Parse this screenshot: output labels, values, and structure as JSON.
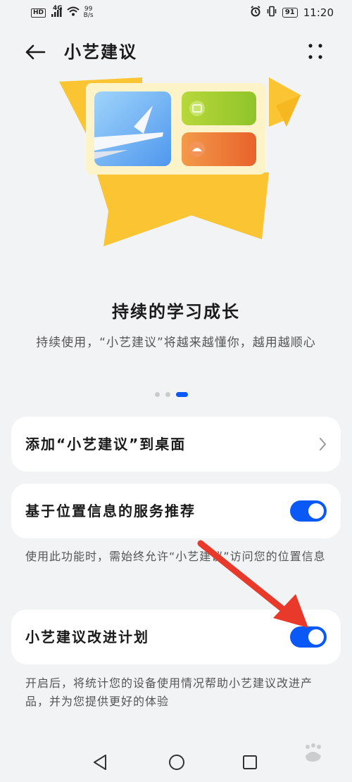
{
  "status_bar": {
    "hd": "HD",
    "net": "4G",
    "speed_value": "99",
    "speed_unit": "B/s",
    "battery": "91",
    "time": "11:20"
  },
  "header": {
    "title": "小艺建议"
  },
  "hero": {
    "headline": "持续的学习成长",
    "subtext": "持续使用，“小艺建议”将越来越懂你，越用越顺心",
    "page_count": 3,
    "active_page": 3
  },
  "settings": {
    "add_to_desktop": "添加“小艺建议”到桌面",
    "location_service": {
      "label": "基于位置信息的服务推荐",
      "enabled": true,
      "note": "使用此功能时，需始终允许“小艺建议”访问您的位置信息"
    },
    "improvement_plan": {
      "label": "小艺建议改进计划",
      "enabled": true,
      "note": "开启后，将统计您的设备使用情况帮助小艺建议改进产品，并为您提供更好的体验"
    }
  },
  "colors": {
    "accent": "#0a59f7",
    "annotation_arrow": "#e8392b"
  },
  "icons": {
    "back": "back-arrow-icon",
    "more": "more-dots-icon",
    "chevron": "chevron-right-icon",
    "nav_back": "triangle-back-icon",
    "nav_home": "circle-home-icon",
    "nav_recent": "square-recent-icon"
  }
}
